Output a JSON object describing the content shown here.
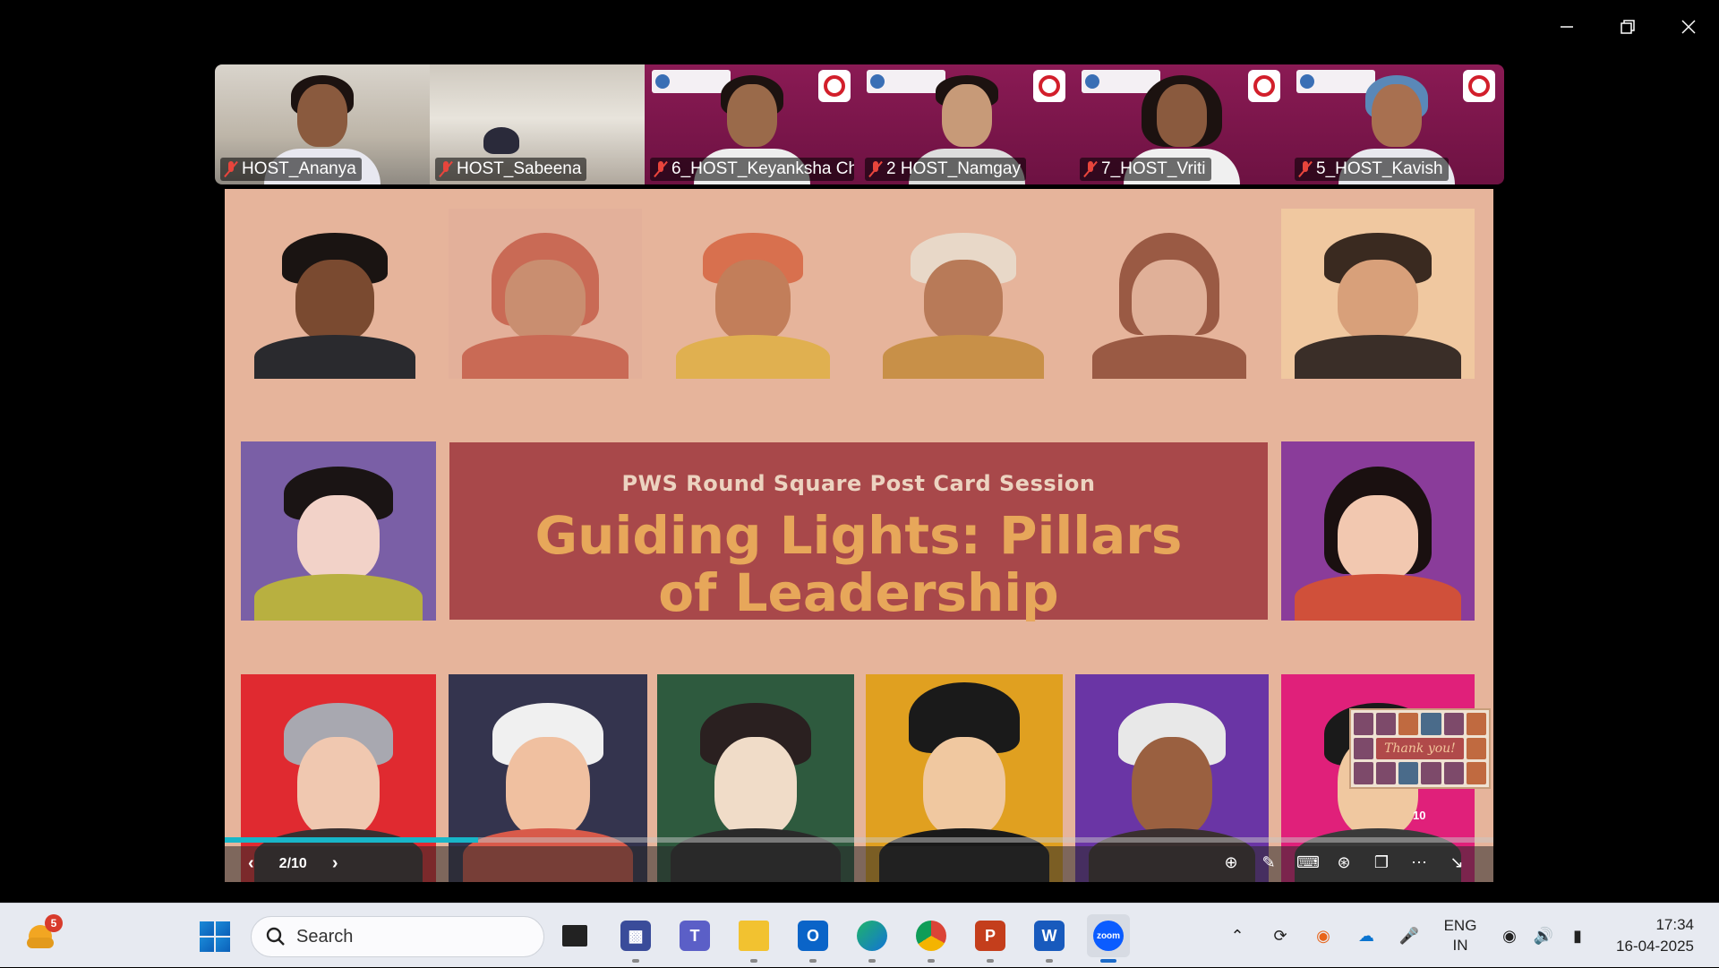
{
  "window": {
    "controls": [
      "minimize",
      "restore",
      "close"
    ]
  },
  "participants": [
    {
      "name": "HOST_Ananya",
      "muted": true,
      "bg": "room"
    },
    {
      "name": "HOST_Sabeena",
      "muted": true,
      "bg": "room2"
    },
    {
      "name": "6_HOST_Keyanksha Ch...",
      "muted": true,
      "bg": "brand"
    },
    {
      "name": "2 HOST_Namgay",
      "muted": true,
      "bg": "brand"
    },
    {
      "name": "7_HOST_Vriti",
      "muted": true,
      "bg": "brand"
    },
    {
      "name": "5_HOST_Kavish",
      "muted": true,
      "bg": "brand"
    }
  ],
  "slide": {
    "subtitle": "PWS Round Square Post Card Session",
    "title": "Guiding Lights: Pillars of Leadership",
    "thank_you_label": "Thank you!",
    "thumb_count": "10",
    "portrait_colors": {
      "top_row_bg": "#e6b49b",
      "side_left_bg": "#7a5fa6",
      "side_right_bg": "#8a3c9a",
      "bottom": [
        "#e02a30",
        "#34344e",
        "#2e5a3e",
        "#e0a020",
        "#6a35a5",
        "#e0207a"
      ]
    }
  },
  "slide_controls": {
    "page_indicator": "2/10",
    "progress_fraction": 0.2,
    "tools": [
      "zoom-icon",
      "pen-icon",
      "keyboard-icon",
      "broadcast-icon",
      "window-icon",
      "more-icon",
      "collapse-icon"
    ]
  },
  "taskbar": {
    "notification_count": "5",
    "search_placeholder": "Search",
    "apps": [
      "task-view",
      "remote-desktop",
      "teams",
      "file-explorer",
      "outlook",
      "edge",
      "chrome",
      "powerpoint",
      "word",
      "zoom"
    ],
    "active_app": "zoom",
    "language_line1": "ENG",
    "language_line2": "IN",
    "time": "17:34",
    "date": "16-04-2025"
  }
}
